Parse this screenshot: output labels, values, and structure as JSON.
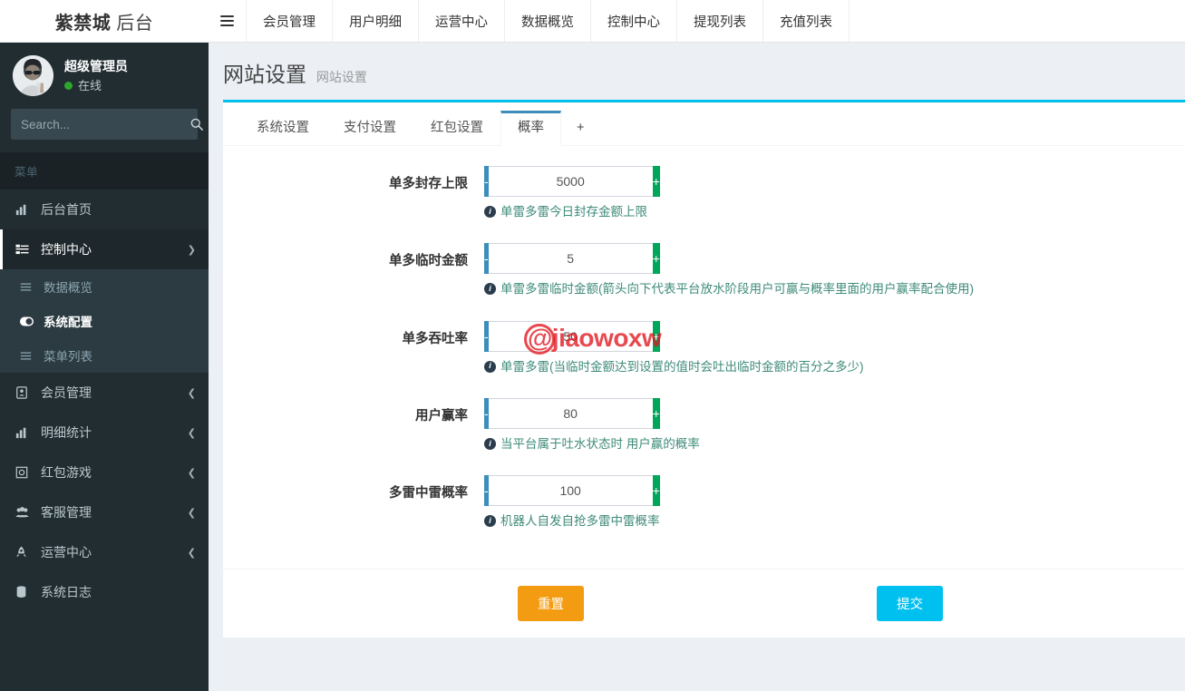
{
  "brand": {
    "bold": "紫禁城",
    "light": " 后台"
  },
  "topnav": {
    "toggle_icon": "hamburger-icon",
    "items": [
      {
        "label": "会员管理"
      },
      {
        "label": "用户明细"
      },
      {
        "label": "运营中心"
      },
      {
        "label": "数据概览"
      },
      {
        "label": "控制中心"
      },
      {
        "label": "提现列表"
      },
      {
        "label": "充值列表"
      }
    ]
  },
  "sidebar": {
    "user": {
      "name": "超级管理员",
      "status": "在线",
      "status_color": "#2ea52c"
    },
    "search": {
      "placeholder": "Search...",
      "value": "",
      "icon": "search-icon"
    },
    "menu_header": "菜单",
    "items": [
      {
        "label": "后台首页",
        "icon": "chart-bar-icon",
        "arrow": "",
        "active": false
      },
      {
        "label": "控制中心",
        "icon": "list-ul-icon",
        "arrow": "chevron-down-icon",
        "active": true
      },
      {
        "label": "会员管理",
        "icon": "user-badge-icon",
        "arrow": "chevron-left-icon",
        "active": false
      },
      {
        "label": "明细统计",
        "icon": "chart-bar-icon",
        "arrow": "chevron-left-icon",
        "active": false
      },
      {
        "label": "红包游戏",
        "icon": "gamepad-icon",
        "arrow": "chevron-left-icon",
        "active": false
      },
      {
        "label": "客服管理",
        "icon": "users-icon",
        "arrow": "chevron-left-icon",
        "active": false
      },
      {
        "label": "运营中心",
        "icon": "rocket-icon",
        "arrow": "chevron-left-icon",
        "active": false
      },
      {
        "label": "系统日志",
        "icon": "database-icon",
        "arrow": "",
        "active": false
      }
    ],
    "submenu": [
      {
        "label": "数据概览",
        "icon": "bars-icon",
        "active": false
      },
      {
        "label": "系统配置",
        "icon": "toggle-on-icon",
        "active": true
      },
      {
        "label": "菜单列表",
        "icon": "bars-icon",
        "active": false
      }
    ]
  },
  "page": {
    "title": "网站设置",
    "subtitle": "网站设置"
  },
  "tabs": [
    {
      "label": "系统设置",
      "active": false
    },
    {
      "label": "支付设置",
      "active": false
    },
    {
      "label": "红包设置",
      "active": false
    },
    {
      "label": "概率",
      "active": true
    },
    {
      "label": "+",
      "active": false
    }
  ],
  "form": {
    "fields": [
      {
        "label": "单多封存上限",
        "value": "5000",
        "minus": "-",
        "plus": "+",
        "help": "单雷多雷今日封存金额上限"
      },
      {
        "label": "单多临时金额",
        "value": "5",
        "minus": "-",
        "plus": "+",
        "help": "单雷多雷临时金额(箭头向下代表平台放水阶段用户可赢与概率里面的用户赢率配合使用)"
      },
      {
        "label": "单多吞吐率",
        "value": "50",
        "minus": "-",
        "plus": "+",
        "help": "单雷多雷(当临时金额达到设置的值时会吐出临时金额的百分之多少)"
      },
      {
        "label": "用户赢率",
        "value": "80",
        "minus": "-",
        "plus": "+",
        "help": "当平台属于吐水状态时 用户赢的概率"
      },
      {
        "label": "多雷中雷概率",
        "value": "100",
        "minus": "-",
        "plus": "+",
        "help": "机器人自发自抢多雷中雷概率"
      }
    ],
    "reset_label": "重置",
    "submit_label": "提交"
  },
  "watermark": {
    "text": "@jiaowoxw",
    "color": "#e1141e"
  },
  "colors": {
    "accent_cyan": "#00c0ef",
    "spin_minus": "#3c8dbc",
    "spin_plus": "#00a65a",
    "reset_orange": "#f39c12",
    "submit_cyan": "#00c0ef",
    "sidebar_dark": "#222d32"
  }
}
